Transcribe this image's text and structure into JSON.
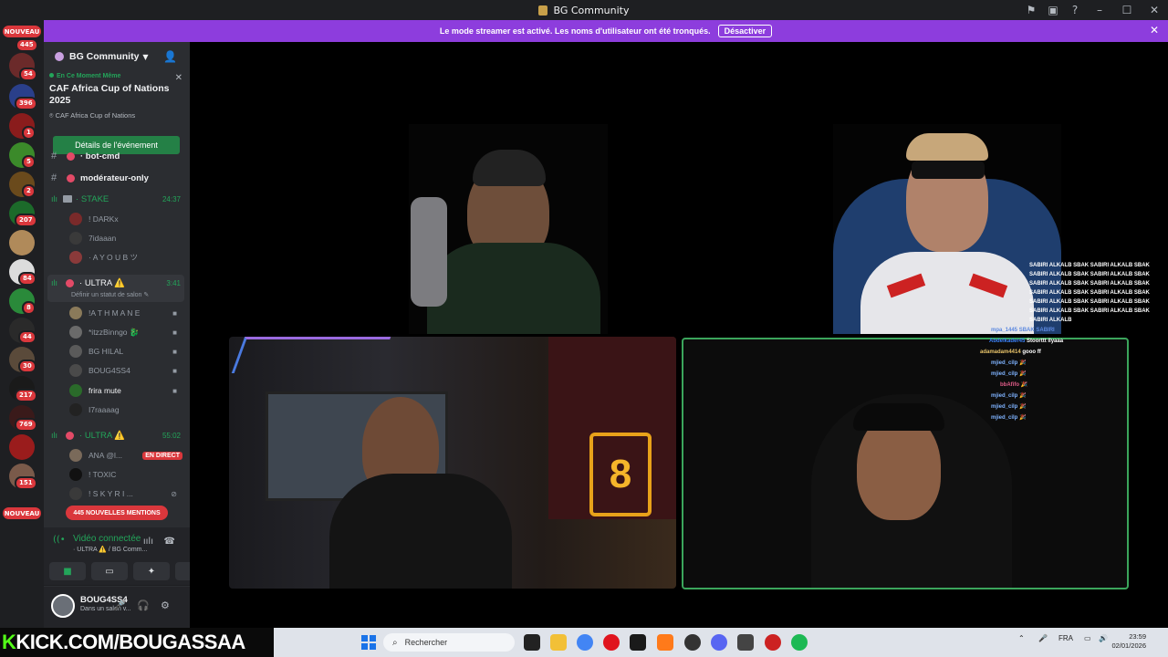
{
  "window": {
    "title": "BG Community"
  },
  "banner": {
    "message": "Le mode streamer est activé. Les noms d'utilisateur ont été tronqués.",
    "button": "Désactiver"
  },
  "rail": {
    "nouveau_top": "NOUVEAU",
    "nouveau_bottom": "NOUVEAU",
    "badges": [
      "445",
      "54",
      "396",
      "1",
      "5",
      "2",
      "207",
      "84",
      "8",
      "44",
      "30",
      "217",
      "769",
      "151"
    ]
  },
  "server": {
    "name": "BG Community"
  },
  "event": {
    "live_label": "En Ce Moment Même",
    "title": "CAF Africa Cup of Nations 2025",
    "location": "CAF Africa Cup of Nations",
    "details_button": "Détails de l'événement"
  },
  "channels": {
    "partial_top": "· bot-cmd",
    "moderator": "modérateur-only",
    "stake": {
      "name": "· STAKE",
      "time": "24:37"
    },
    "stake_users": [
      "! DARKx",
      "7idaaan",
      "· A Y O U B ツ"
    ],
    "ultra1": {
      "name": "· ULTRA ⚠️",
      "time": "3:41",
      "status": "Définir un statut de salon"
    },
    "ultra1_users": [
      "!A T H M A N E",
      "*itzzBinngo 🐉",
      "BG HILAL",
      "BOUG4SS4",
      "frira mute",
      "I7raaaag"
    ],
    "ultra2": {
      "name": "· ULTRA ⚠️",
      "time": "55:02"
    },
    "ultra2_users": [
      "ANA @l...",
      "! TOXIC",
      "! S K Y R I ..."
    ],
    "live_tag": "EN DIRECT",
    "mentions": "445 NOUVELLES MENTIONS"
  },
  "voice": {
    "status": "Vidéo connectée",
    "location": "· ULTRA ⚠️ / BG Comm..."
  },
  "user": {
    "name": "BOUG4SS4",
    "status": "Dans un salon v..."
  },
  "overlay_chat": {
    "top_lines": [
      "SABIRI ALKALB SBAK SABIRI ALKALB SBAK",
      "SABIRI ALKALB SBAK SABIRI ALKALB SBAK",
      "SABIRI ALKALB SBAK SABIRI ALKALB SBAK",
      "SABIRI ALKALB SBAK SABIRI ALKALB SBAK",
      "SABIRI ALKALB SBAK SABIRI ALKALB SBAK",
      "SABIRI ALKALB SBAK SABIRI ALKALB SBAK",
      "SABIRI ALKALB"
    ],
    "mid_line": "mpa_1445 SBAK SABIRI",
    "messages": [
      {
        "user": "Abdelkader45",
        "text": "Stoorttt ilyaaa",
        "color": "#3b82f6"
      },
      {
        "user": "adamadam4414",
        "text": "gooo ff",
        "color": "#e9c46a"
      },
      {
        "user": "mjied_cilp",
        "text": "🎉",
        "color": "#7fb3ff"
      },
      {
        "user": "mjied_cilp",
        "text": "🎉",
        "color": "#7fb3ff"
      },
      {
        "user": "bbAfifo",
        "text": "🎉",
        "color": "#e35d8a"
      },
      {
        "user": "mjied_cilp",
        "text": "🎉",
        "color": "#7fb3ff"
      },
      {
        "user": "mjied_cilp",
        "text": "🎉",
        "color": "#7fb3ff"
      },
      {
        "user": "mjied_cilp",
        "text": "🎉",
        "color": "#7fb3ff"
      }
    ]
  },
  "taskbar": {
    "kick_prefix": "K",
    "kick_text": "KICK.COM/BOUGASSAA",
    "search": "Rechercher",
    "lang": "FRA",
    "time": "23:59",
    "date": "02/01/2026"
  }
}
